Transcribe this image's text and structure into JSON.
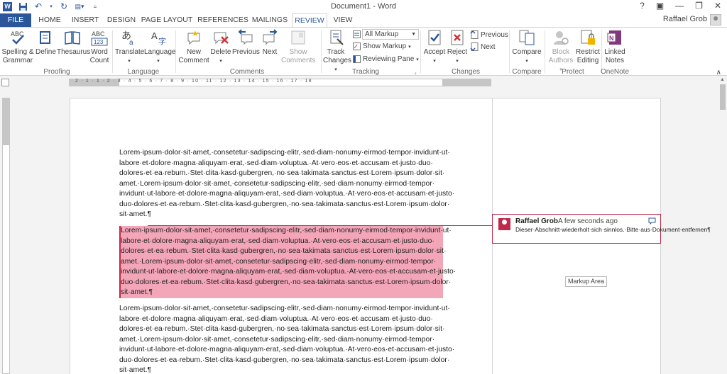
{
  "window": {
    "title": "Document1 - Word",
    "user": "Raffael Grob"
  },
  "tabs": [
    "FILE",
    "HOME",
    "INSERT",
    "DESIGN",
    "PAGE LAYOUT",
    "REFERENCES",
    "MAILINGS",
    "REVIEW",
    "VIEW"
  ],
  "active_tab": "REVIEW",
  "ribbon": {
    "proofing": {
      "label": "Proofing",
      "spelling": "Spelling & Grammar",
      "define": "Define",
      "thesaurus": "Thesaurus",
      "word_count": "Word Count"
    },
    "language": {
      "label": "Language",
      "translate": "Translate",
      "language": "Language"
    },
    "comments": {
      "label": "Comments",
      "new": "New Comment",
      "delete": "Delete",
      "previous": "Previous",
      "next": "Next",
      "show": "Show Comments"
    },
    "tracking": {
      "label": "Tracking",
      "track": "Track Changes",
      "markup_select": "All Markup",
      "show_markup": "Show Markup",
      "reviewing_pane": "Reviewing Pane"
    },
    "changes": {
      "label": "Changes",
      "accept": "Accept",
      "reject": "Reject",
      "previous": "Previous",
      "next": "Next"
    },
    "compare": {
      "label": "Compare",
      "compare": "Compare"
    },
    "protect": {
      "label": "Protect",
      "block": "Block Authors",
      "restrict": "Restrict Editing"
    },
    "onenote": {
      "label": "OneNote",
      "linked": "Linked Notes"
    }
  },
  "document": {
    "para1": [
      "Lorem·ipsum·dolor·sit·amet,·consetetur·sadipscing·elitr,·sed·diam·nonumy·eirmod·tempor·invidunt·ut·",
      "labore·et·dolore·magna·aliquyam·erat,·sed·diam·voluptua.·At·vero·eos·et·accusam·et·justo·duo·",
      "dolores·et·ea·rebum.·Stet·clita·kasd·gubergren,·no·sea·takimata·sanctus·est·Lorem·ipsum·dolor·sit·",
      "amet.·Lorem·ipsum·dolor·sit·amet,·consetetur·sadipscing·elitr,·sed·diam·nonumy·eirmod·tempor·",
      "invidunt·ut·labore·et·dolore·magna·aliquyam·erat,·sed·diam·voluptua.·At·vero·eos·et·accusam·et·justo·",
      "duo·dolores·et·ea·rebum.·Stet·clita·kasd·gubergren,·no·sea·takimata·sanctus·est·Lorem·ipsum·dolor·",
      "sit·amet.¶"
    ],
    "para2": [
      "Lorem·ipsum·dolor·sit·amet,·consetetur·sadipscing·elitr,·sed·diam·nonumy·eirmod·tempor·invidunt·ut·",
      "labore·et·dolore·magna·aliquyam·erat,·sed·diam·voluptua.·At·vero·eos·et·accusam·et·justo·duo·",
      "dolores·et·ea·rebum.·Stet·clita·kasd·gubergren,·no·sea·takimata·sanctus·est·Lorem·ipsum·dolor·sit·",
      "amet.·Lorem·ipsum·dolor·sit·amet,·consetetur·sadipscing·elitr,·sed·diam·nonumy·eirmod·tempor·",
      "invidunt·ut·labore·et·dolore·magna·aliquyam·erat,·sed·diam·voluptua.·At·vero·eos·et·accusam·et·justo·",
      "duo·dolores·et·ea·rebum.·Stet·clita·kasd·gubergren,·no·sea·takimata·sanctus·est·Lorem·ipsum·dolor·",
      "sit·amet.¶"
    ],
    "para3": [
      "Lorem·ipsum·dolor·sit·amet,·consetetur·sadipscing·elitr,·sed·diam·nonumy·eirmod·tempor·invidunt·ut·",
      "labore·et·dolore·magna·aliquyam·erat,·sed·diam·voluptua.·At·vero·eos·et·accusam·et·justo·duo·",
      "dolores·et·ea·rebum.·Stet·clita·kasd·gubergren,·no·sea·takimata·sanctus·est·Lorem·ipsum·dolor·sit·",
      "amet.·Lorem·ipsum·dolor·sit·amet,·consetetur·sadipscing·elitr,·sed·diam·nonumy·eirmod·tempor·",
      "invidunt·ut·labore·et·dolore·magna·aliquyam·erat,·sed·diam·voluptua.·At·vero·eos·et·accusam·et·justo·",
      "duo·dolores·et·ea·rebum.·Stet·clita·kasd·gubergren,·no·sea·takimata·sanctus·est·Lorem·ipsum·dolor·",
      "sit·amet.¶"
    ]
  },
  "comment": {
    "author": "Raffael Grob",
    "time": "A few seconds ago",
    "text": "Dieser·Abschnitt·wiederholt·sich·sinnlos.·Bitte·aus·Dokument·entfernen¶"
  },
  "tooltip": "Markup Area",
  "ruler_numbers": "2 · 1 · 1 · 2 · 3 · 4 · 5 · 6 · 7 · 8 · 9 · 10 · 11 · 12 · 13 · 14 · 15 · 16 · 17 · 18",
  "colors": {
    "accent": "#2b579a",
    "comment": "#c0294a",
    "highlight": "#f4a6b9"
  }
}
